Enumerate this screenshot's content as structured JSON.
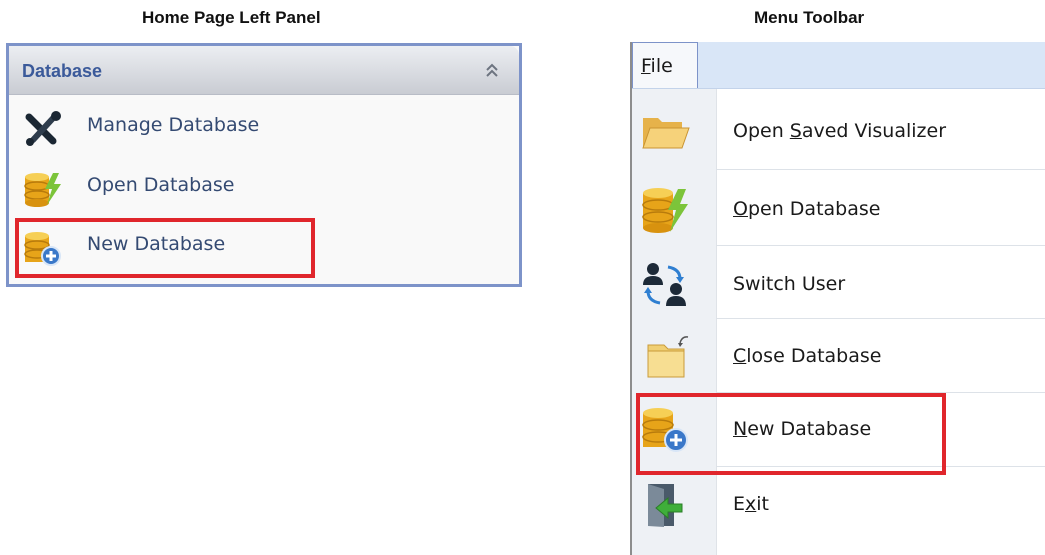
{
  "captions": {
    "left": "Home Page Left Panel",
    "right": "Menu Toolbar"
  },
  "left_panel": {
    "title": "Database",
    "collapse_icon": "double-chevron-up-icon",
    "items": [
      {
        "label": "Manage Database",
        "icon": "wrench-screwdriver-icon"
      },
      {
        "label": "Open Database",
        "icon": "database-lightning-icon"
      },
      {
        "label": "New Database",
        "icon": "database-add-icon",
        "highlighted": true
      }
    ]
  },
  "menu": {
    "file_tab": {
      "label": "File",
      "mnemonic": "F"
    },
    "items": [
      {
        "label": "Open Saved Visualizer",
        "mnemonic": "S",
        "icon": "folder-open-icon"
      },
      {
        "label": "Open Database",
        "mnemonic": "O",
        "icon": "database-lightning-icon"
      },
      {
        "label": "Switch User",
        "mnemonic": "",
        "icon": "switch-user-icon"
      },
      {
        "label": "Close Database",
        "mnemonic": "C",
        "icon": "folder-close-icon"
      },
      {
        "label": "New Database",
        "mnemonic": "N",
        "icon": "database-add-icon",
        "highlighted": true
      },
      {
        "label": "Exit",
        "mnemonic": "x",
        "icon": "exit-door-icon"
      }
    ]
  },
  "colors": {
    "highlight": "#e0262c",
    "panel_border": "#7d93c9",
    "panel_title": "#3b5a9a",
    "menubar": "#d9e6f7"
  }
}
